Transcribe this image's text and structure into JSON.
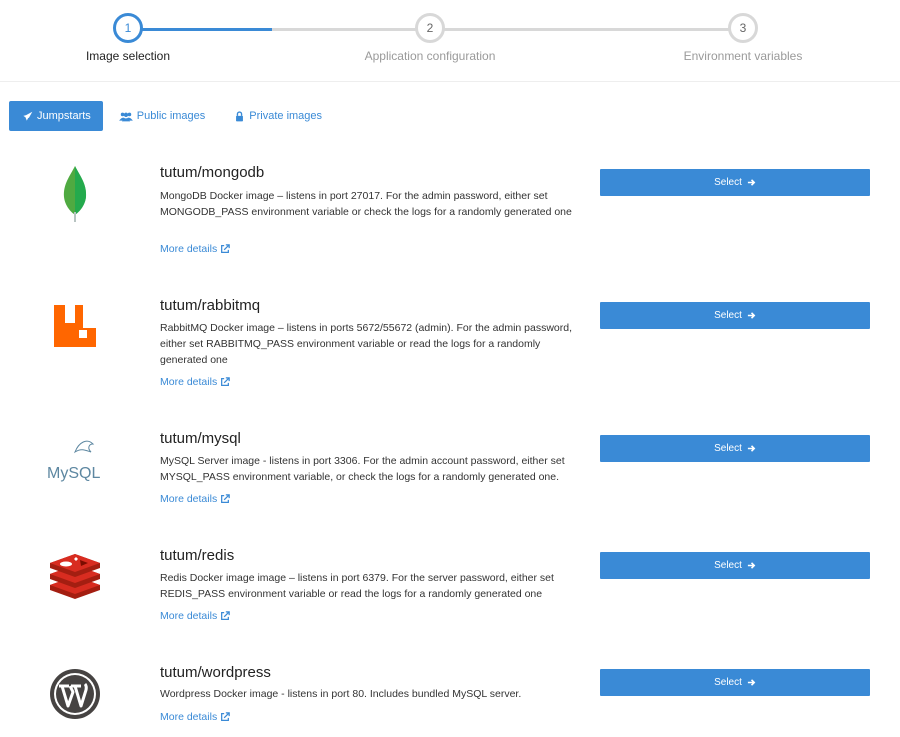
{
  "wizard": {
    "steps": [
      {
        "number": "1",
        "label": "Image selection"
      },
      {
        "number": "2",
        "label": "Application configuration"
      },
      {
        "number": "3",
        "label": "Environment variables"
      }
    ]
  },
  "tabs": {
    "jumpstarts": "Jumpstarts",
    "public": "Public images",
    "private": "Private images"
  },
  "images": [
    {
      "name": "tutum/mongodb",
      "description": "MongoDB Docker image – listens in port 27017. For the admin password, either set MONGODB_PASS environment variable or check the logs for a randomly generated one",
      "more": "More details",
      "select": "Select"
    },
    {
      "name": "tutum/rabbitmq",
      "description": "RabbitMQ Docker image – listens in ports 5672/55672 (admin). For the admin password, either set RABBITMQ_PASS environment variable or read the logs for a randomly generated one",
      "more": "More details",
      "select": "Select"
    },
    {
      "name": "tutum/mysql",
      "description": "MySQL Server image - listens in port 3306. For the admin account password, either set MYSQL_PASS environment variable, or check the logs for a randomly generated one.",
      "more": "More details",
      "select": "Select",
      "logo_text": "MySQL"
    },
    {
      "name": "tutum/redis",
      "description": "Redis Docker image image – listens in port 6379. For the server password, either set REDIS_PASS environment variable or read the logs for a randomly generated one",
      "more": "More details",
      "select": "Select"
    },
    {
      "name": "tutum/wordpress",
      "description": "Wordpress Docker image - listens in port 80. Includes bundled MySQL server.",
      "more": "More details",
      "select": "Select"
    }
  ],
  "colors": {
    "accent": "#3a8ad6",
    "step_inactive": "#d8d8d8"
  }
}
